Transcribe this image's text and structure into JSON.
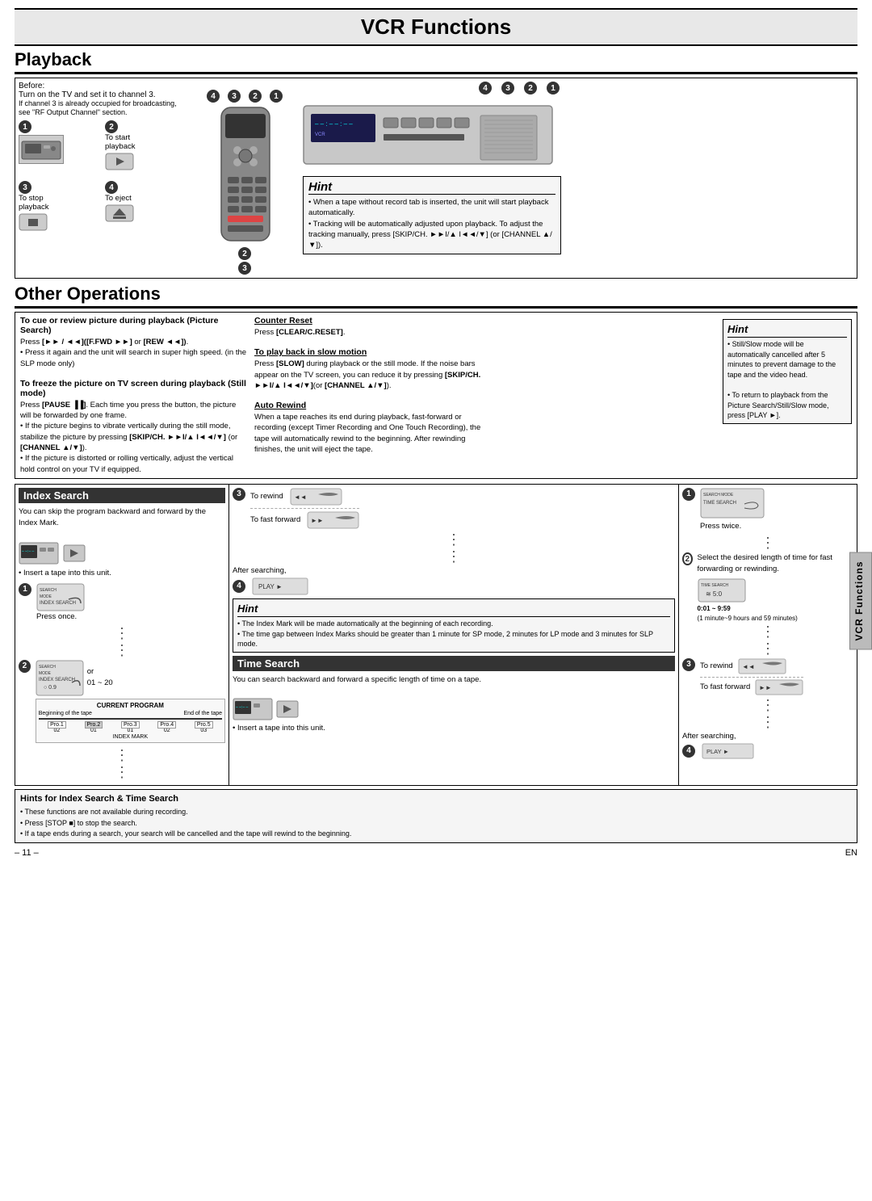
{
  "page": {
    "title": "VCR Functions",
    "footer_page": "– 11 –",
    "footer_lang": "EN"
  },
  "playback": {
    "section_title": "Playback",
    "before_label": "Before:",
    "before_text": "Turn on the TV and set it to channel 3.",
    "before_note": "If channel 3 is already occupied for broadcasting, see \"RF Output Channel\" section.",
    "steps": [
      {
        "num": "1",
        "label": ""
      },
      {
        "num": "2",
        "label": "To start playback"
      },
      {
        "num": "3",
        "label": "To stop playback"
      },
      {
        "num": "4",
        "label": "To eject"
      }
    ],
    "hint_title": "Hint",
    "hint_bullets": [
      "When a tape without record tab is inserted, the unit will start playback automatically.",
      "Tracking will be automatically adjusted upon playback. To adjust the tracking manually, press [SKIP/CH. ►►I/▲ I◄◄/▼] (or [CHANNEL ▲/▼])."
    ]
  },
  "other_ops": {
    "section_title": "Other Operations",
    "cols": [
      {
        "heading": "To cue or review picture during playback (Picture Search)",
        "paragraphs": [
          "Press [►► / ◄◄]([F.FWD ►►] or [REW ◄◄]).",
          "Press it again and the unit will search in super high speed. (in the SLP mode only)"
        ]
      },
      {
        "heading": "To freeze the picture on TV screen during playback (Still mode)",
        "paragraphs": [
          "Press [PAUSE ▐▐]. Each time you press the button, the picture will be forwarded by one frame.",
          "If the picture begins to vibrate vertically during the still mode, stabilize the picture by pressing [SKIP/CH. ►►I/▲ I◄◄/▼] (or [CHANNEL ▲/▼]).",
          "If the picture is distorted or rolling vertically, adjust the vertical hold control on your TV if equipped."
        ]
      },
      {
        "cols2_heading1": "Counter Reset",
        "cols2_text1": "Press [CLEAR/C.RESET].",
        "cols2_heading2": "To play back in slow motion",
        "cols2_text2": "Press [SLOW] during playback or the still mode. If the noise bars appear on the TV screen, you can reduce it by pressing [SKIP/CH. ►►I/▲ I◄◄/▼](or [CHANNEL ▲/▼]).",
        "cols2_heading3": "Auto Rewind",
        "cols2_text3": "When a tape reaches its end during playback, fast-forward or recording (except Timer Recording and One Touch Recording), the tape will automatically rewind to the beginning. After rewinding finishes, the unit will eject the tape."
      }
    ],
    "hint_title": "Hint",
    "hint_bullets": [
      "Still/Slow mode will be automatically cancelled after 5 minutes to prevent damage to the tape and the video head.",
      "To return to playback from the Picture Search/Still/Slow mode, press [PLAY ►]."
    ]
  },
  "index_search": {
    "title": "Index Search",
    "text1": "You can skip the program backward and forward by the Index Mark.",
    "text2": "Insert a tape into this unit.",
    "step1_label": "Press once.",
    "step2_label": "or",
    "step2_range": "01 ~ 20",
    "diagram_label": "CURRENT PROGRAM",
    "diagram_programs": [
      "Pro.1",
      "Pro.2",
      "Pro.3",
      "Pro.4",
      "Pro.5"
    ],
    "diagram_nums": [
      "02",
      "01",
      "01",
      "02",
      "03"
    ],
    "beginning": "Beginning of the tape",
    "end": "End of the tape",
    "index_mark": "INDEX MARK"
  },
  "index_rewind_fwd": {
    "step3_label": "3",
    "rewind_label": "To rewind",
    "fwd_label": "To fast forward",
    "after_label": "After searching,",
    "step4_label": "4",
    "hint_title": "Hint",
    "hint_bullets": [
      "The Index Mark will be made automatically at the beginning of each recording.",
      "The time gap between Index Marks should be greater than 1 minute for SP mode, 2 minutes for LP mode and 3 minutes for SLP mode."
    ]
  },
  "time_search": {
    "title": "Time Search",
    "text": "You can search backward and forward a specific length of time on a tape.",
    "text2": "Insert a tape into this unit.",
    "step1_label": "Press twice.",
    "step2_label": "Select the desired length of time for fast forwarding or rewinding.",
    "time_range": "0:01 ~ 9:59",
    "time_note": "(1 minute~9 hours and 59 minutes)",
    "step3_label": "3",
    "rewind_label": "To rewind",
    "fwd_label": "To fast forward",
    "after_label": "After searching,",
    "step4_label": "4"
  },
  "hints_footer": {
    "title": "Hints for Index Search & Time Search",
    "bullets": [
      "These functions are not available during recording.",
      "Press [STOP ■] to stop the search.",
      "If a tape ends during a search, your search will be cancelled and the tape will rewind to the beginning."
    ]
  },
  "vcr_sidebar": "VCR Functions",
  "step_labels": {
    "step1": "1",
    "step2": "2",
    "step3": "3",
    "step4": "4"
  }
}
